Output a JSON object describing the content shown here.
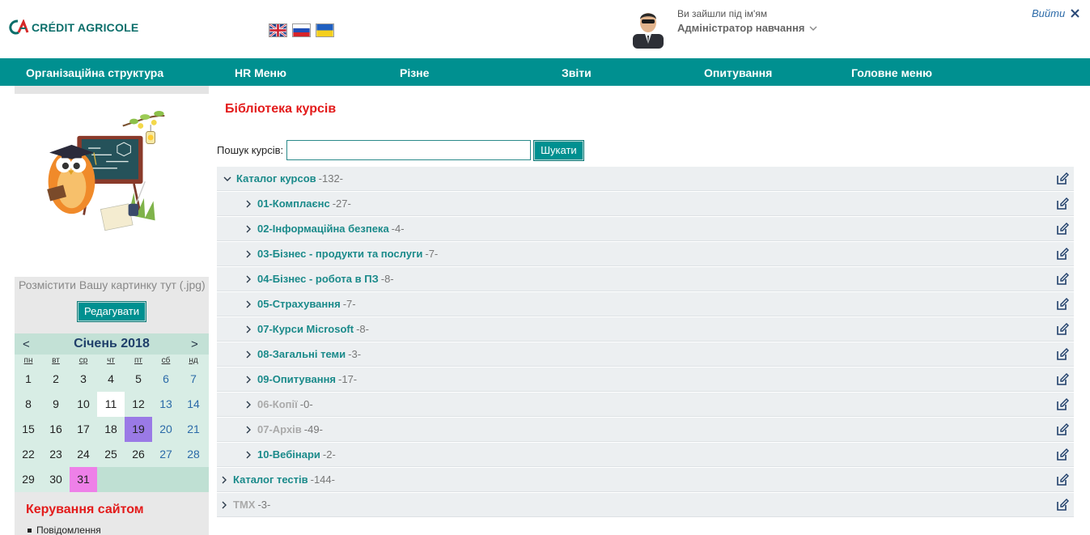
{
  "header": {
    "logo_text": "CRÉDIT AGRICOLE",
    "user_caption": "Ви зайшли під ім'ям",
    "user_name": "Адміністратор навчання",
    "logout_label": "Вийти"
  },
  "nav": {
    "items": [
      "Організаційна структура",
      "HR Меню",
      "Різне",
      "Звіти",
      "Опитування",
      "Головне меню"
    ]
  },
  "sidebar": {
    "picture_caption": "Розмістити Вашу картинку тут (.jpg)",
    "edit_label": "Редагувати",
    "calendar": {
      "prev": "<",
      "next": ">",
      "title": "Січень 2018",
      "weekdays": [
        "пн",
        "вт",
        "ср",
        "чт",
        "пт",
        "сб",
        "нд"
      ],
      "days": [
        "1",
        "2",
        "3",
        "4",
        "5",
        "6",
        "7",
        "8",
        "9",
        "10",
        "11",
        "12",
        "13",
        "14",
        "15",
        "16",
        "17",
        "18",
        "19",
        "20",
        "21",
        "22",
        "23",
        "24",
        "25",
        "26",
        "27",
        "28",
        "29",
        "30",
        "31"
      ]
    },
    "manage_title": "Керування сайтом",
    "manage_items": [
      "Повідомлення"
    ]
  },
  "main": {
    "title": "Бібліотека курсів",
    "search_label": "Пошук курсів:",
    "search_value": "",
    "search_button": "Шукати",
    "tree": [
      {
        "label": "Каталог курсов",
        "count": "-132-"
      },
      {
        "label": "01-Комплаєнс",
        "count": "-27-"
      },
      {
        "label": "02-Інформаційна безпека",
        "count": "-4-"
      },
      {
        "label": "03-Бізнес - продукти та послуги",
        "count": "-7-"
      },
      {
        "label": "04-Бізнес - робота в ПЗ",
        "count": "-8-"
      },
      {
        "label": "05-Страхування",
        "count": "-7-"
      },
      {
        "label": "07-Курси Microsoft",
        "count": "-8-"
      },
      {
        "label": "08-Загальні теми",
        "count": "-3-"
      },
      {
        "label": "09-Опитування",
        "count": "-17-"
      },
      {
        "label": "06-Копії",
        "count": "-0-"
      },
      {
        "label": "07-Архів",
        "count": "-49-"
      },
      {
        "label": "10-Вебінари",
        "count": "-2-"
      },
      {
        "label": "Каталог тестів",
        "count": "-144-"
      },
      {
        "label": "ТМХ",
        "count": "-3-"
      }
    ]
  },
  "colors": {
    "nav_bg": "#009090",
    "title_red": "#e31b1b",
    "link_teal": "#1a8a8a"
  }
}
